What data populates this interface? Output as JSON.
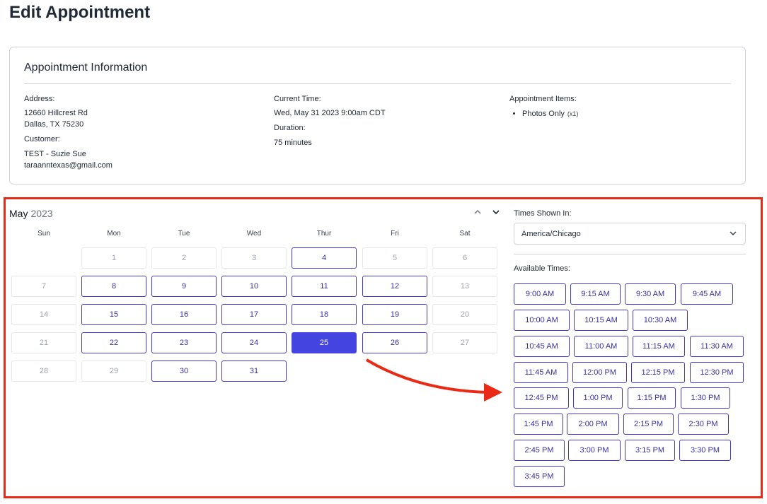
{
  "page": {
    "title": "Edit Appointment"
  },
  "info": {
    "title": "Appointment Information",
    "address_label": "Address:",
    "address_line1": "12660 Hillcrest Rd",
    "address_line2": "Dallas, TX 75230",
    "customer_label": "Customer:",
    "customer_name": "TEST - Suzie Sue",
    "customer_email": "taraanntexas@gmail.com",
    "current_time_label": "Current Time:",
    "current_time": "Wed, May 31 2023 9:00am CDT",
    "duration_label": "Duration:",
    "duration": "75 minutes",
    "items_label": "Appointment Items:",
    "items": [
      {
        "name": "Photos Only",
        "qty": "(x1)"
      }
    ]
  },
  "calendar": {
    "month": "May",
    "year": "2023",
    "weekdays": [
      "Sun",
      "Mon",
      "Tue",
      "Wed",
      "Thur",
      "Fri",
      "Sat"
    ],
    "days": [
      {
        "label": "1",
        "state": "disabled"
      },
      {
        "label": "2",
        "state": "disabled"
      },
      {
        "label": "3",
        "state": "disabled"
      },
      {
        "label": "4",
        "state": "available"
      },
      {
        "label": "5",
        "state": "disabled"
      },
      {
        "label": "6",
        "state": "disabled"
      },
      {
        "label": "7",
        "state": "disabled"
      },
      {
        "label": "8",
        "state": "available"
      },
      {
        "label": "9",
        "state": "available"
      },
      {
        "label": "10",
        "state": "available"
      },
      {
        "label": "11",
        "state": "available"
      },
      {
        "label": "12",
        "state": "available"
      },
      {
        "label": "13",
        "state": "disabled"
      },
      {
        "label": "14",
        "state": "disabled"
      },
      {
        "label": "15",
        "state": "available"
      },
      {
        "label": "16",
        "state": "available"
      },
      {
        "label": "17",
        "state": "available"
      },
      {
        "label": "18",
        "state": "available"
      },
      {
        "label": "19",
        "state": "available"
      },
      {
        "label": "20",
        "state": "disabled"
      },
      {
        "label": "21",
        "state": "disabled"
      },
      {
        "label": "22",
        "state": "available"
      },
      {
        "label": "23",
        "state": "available"
      },
      {
        "label": "24",
        "state": "available"
      },
      {
        "label": "25",
        "state": "selected"
      },
      {
        "label": "26",
        "state": "available"
      },
      {
        "label": "27",
        "state": "disabled"
      },
      {
        "label": "28",
        "state": "disabled"
      },
      {
        "label": "29",
        "state": "disabled"
      },
      {
        "label": "30",
        "state": "available"
      },
      {
        "label": "31",
        "state": "available"
      }
    ],
    "nav_icons": [
      "chevron-up-icon",
      "chevron-down-icon"
    ]
  },
  "timezone": {
    "label": "Times Shown In:",
    "value": "America/Chicago"
  },
  "times": {
    "label": "Available Times:",
    "slots": [
      "9:00 AM",
      "9:15 AM",
      "9:30 AM",
      "9:45 AM",
      "10:00 AM",
      "10:15 AM",
      "10:30 AM",
      "10:45 AM",
      "11:00 AM",
      "11:15 AM",
      "11:30 AM",
      "11:45 AM",
      "12:00 PM",
      "12:15 PM",
      "12:30 PM",
      "12:45 PM",
      "1:00 PM",
      "1:15 PM",
      "1:30 PM",
      "1:45 PM",
      "2:00 PM",
      "2:15 PM",
      "2:30 PM",
      "2:45 PM",
      "3:00 PM",
      "3:15 PM",
      "3:30 PM",
      "3:45 PM"
    ]
  },
  "colors": {
    "accent": "#4338ca",
    "selected": "#4444e0",
    "annotation": "#ea2a14"
  }
}
